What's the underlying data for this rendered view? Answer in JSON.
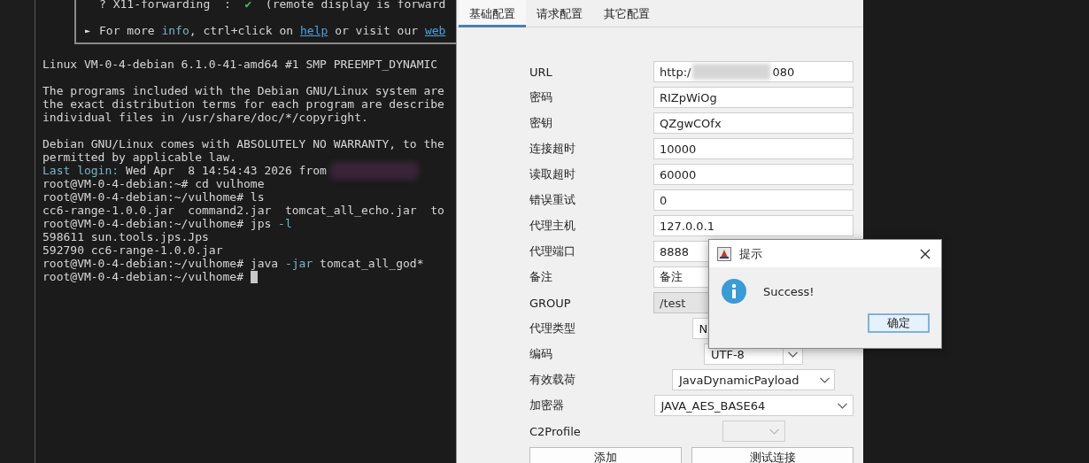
{
  "terminal": {
    "box_lines": [
      {
        "segments": [
          {
            "kind": "plain",
            "text": "? X11-forwarding  :  "
          },
          {
            "kind": "check",
            "text": "✔"
          },
          {
            "kind": "plain",
            "text": "  (remote display is forward"
          }
        ]
      },
      {
        "segments": [
          {
            "kind": "bullet",
            "text": "►"
          },
          {
            "kind": "plain",
            "text": "For more "
          },
          {
            "kind": "accent",
            "text": "info"
          },
          {
            "kind": "plain",
            "text": ", ctrl+click on "
          },
          {
            "kind": "link",
            "text": "help"
          },
          {
            "kind": "plain",
            "text": " or visit our "
          },
          {
            "kind": "link",
            "text": "web"
          }
        ]
      }
    ],
    "blocks": [
      [
        {
          "segments": [
            {
              "kind": "plain",
              "text": "Linux VM-0-4-debian 6.1.0-41-amd64 #1 SMP PREEMPT_DYNAMIC"
            }
          ]
        }
      ],
      [
        {
          "segments": [
            {
              "kind": "plain",
              "text": "The programs included with the Debian GNU/Linux system are"
            }
          ]
        },
        {
          "segments": [
            {
              "kind": "plain",
              "text": "the exact distribution terms for each program are describe"
            }
          ]
        },
        {
          "segments": [
            {
              "kind": "plain",
              "text": "individual files in /usr/share/doc/*/copyright."
            }
          ]
        }
      ],
      [
        {
          "segments": [
            {
              "kind": "plain",
              "text": "Debian GNU/Linux comes with ABSOLUTELY NO WARRANTY, to the"
            }
          ]
        },
        {
          "segments": [
            {
              "kind": "plain",
              "text": "permitted by applicable law."
            }
          ]
        },
        {
          "segments": [
            {
              "kind": "accent",
              "text": "Last login:"
            },
            {
              "kind": "plain",
              "text": " Wed Apr  8 14:54:43 2026 from"
            },
            {
              "kind": "blur"
            }
          ]
        },
        {
          "segments": [
            {
              "kind": "plain",
              "text": "root@VM-0-4-debian:~# cd vulhome"
            }
          ]
        },
        {
          "segments": [
            {
              "kind": "plain",
              "text": "root@VM-0-4-debian:~/vulhome# ls"
            }
          ]
        },
        {
          "segments": [
            {
              "kind": "plain",
              "text": "cc6-range-1.0.0.jar  command2.jar  tomcat_all_echo.jar  to"
            }
          ]
        },
        {
          "segments": [
            {
              "kind": "plain",
              "text": "root@VM-0-4-debian:~/vulhome# jps "
            },
            {
              "kind": "accent",
              "text": "-l"
            }
          ]
        },
        {
          "segments": [
            {
              "kind": "plain",
              "text": "598611 sun.tools.jps.Jps"
            }
          ]
        },
        {
          "segments": [
            {
              "kind": "plain",
              "text": "592790 cc6-range-1.0.0.jar"
            }
          ]
        },
        {
          "segments": [
            {
              "kind": "plain",
              "text": "root@VM-0-4-debian:~/vulhome# java "
            },
            {
              "kind": "accent",
              "text": "-jar"
            },
            {
              "kind": "plain",
              "text": " tomcat_all_god*"
            }
          ]
        },
        {
          "segments": [
            {
              "kind": "plain",
              "text": "root@VM-0-4-debian:~/vulhome# "
            }
          ]
        }
      ]
    ],
    "cursor": true
  },
  "window": {
    "tabs": [
      {
        "label": "基础配置",
        "selected": true
      },
      {
        "label": "请求配置",
        "selected": false
      },
      {
        "label": "其它配置",
        "selected": false
      }
    ],
    "fields": [
      {
        "label": "URL",
        "kind": "text",
        "value": "http:/",
        "value_tail": "080",
        "disabled": false
      },
      {
        "label": "密码",
        "kind": "text",
        "value": "RIZpWiOg",
        "disabled": false
      },
      {
        "label": "密钥",
        "kind": "text",
        "value": "QZgwCOfx",
        "disabled": false
      },
      {
        "label": "连接超时",
        "kind": "text",
        "value": "10000",
        "disabled": false
      },
      {
        "label": "读取超时",
        "kind": "text",
        "value": "60000",
        "disabled": false
      },
      {
        "label": "错误重试",
        "kind": "text",
        "value": "0",
        "disabled": false
      },
      {
        "label": "代理主机",
        "kind": "text",
        "value": "127.0.0.1",
        "disabled": false
      },
      {
        "label": "代理端口",
        "kind": "text",
        "value": "8888",
        "disabled": false
      },
      {
        "label": "备注",
        "kind": "text",
        "value": "备注",
        "disabled": false
      },
      {
        "label": "GROUP",
        "kind": "text",
        "value": "/test",
        "disabled": true
      },
      {
        "label": "代理类型",
        "kind": "combo",
        "value": "N",
        "disabled": false
      },
      {
        "label": "编码",
        "kind": "combo",
        "value": "UTF-8",
        "disabled": false
      },
      {
        "label": "有效载荷",
        "kind": "combo",
        "value": "JavaDynamicPayload",
        "disabled": false
      },
      {
        "label": "加密器",
        "kind": "combo",
        "value": "JAVA_AES_BASE64",
        "disabled": false
      },
      {
        "label": "C2Profile",
        "kind": "combo",
        "disabled": true
      }
    ],
    "buttons": [
      "添加",
      "测试连接"
    ]
  },
  "dialog": {
    "title": "提示",
    "message": "Success!",
    "button": "确定"
  }
}
